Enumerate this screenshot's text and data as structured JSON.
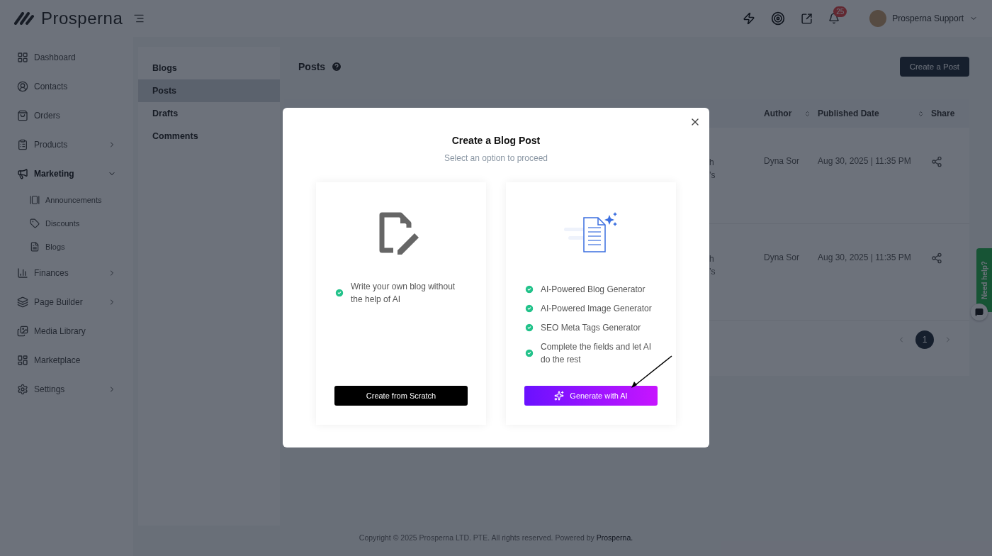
{
  "header": {
    "brand": "Prosperna",
    "notification_count": "25",
    "user_name": "Prosperna Support"
  },
  "sidebar": {
    "items": [
      {
        "label": "Dashboard",
        "kind": "link",
        "selected": false
      },
      {
        "label": "Contacts",
        "kind": "link",
        "selected": false
      },
      {
        "label": "Orders",
        "kind": "link",
        "selected": false
      },
      {
        "label": "Products",
        "kind": "group",
        "selected": false,
        "expanded": false
      },
      {
        "label": "Marketing",
        "kind": "group",
        "selected": true,
        "expanded": true,
        "children": [
          {
            "label": "Announcements"
          },
          {
            "label": "Discounts"
          },
          {
            "label": "Blogs"
          }
        ]
      },
      {
        "label": "Finances",
        "kind": "group",
        "selected": false,
        "expanded": false
      },
      {
        "label": "Page Builder",
        "kind": "group",
        "selected": false,
        "expanded": false
      },
      {
        "label": "Media Library",
        "kind": "link",
        "selected": false
      },
      {
        "label": "Marketplace",
        "kind": "link",
        "selected": false
      },
      {
        "label": "Settings",
        "kind": "group",
        "selected": false,
        "expanded": false
      }
    ]
  },
  "subnav": [
    {
      "label": "Blogs",
      "selected": false
    },
    {
      "label": "Posts",
      "selected": true
    },
    {
      "label": "Drafts",
      "selected": false
    },
    {
      "label": "Comments",
      "selected": false
    }
  ],
  "page": {
    "title": "Posts",
    "create_button": "Create a Post"
  },
  "table": {
    "columns": [
      {
        "label": "Author",
        "sortable": true
      },
      {
        "label": "Published Date",
        "sortable": true
      },
      {
        "label": "Share"
      }
    ],
    "rows": [
      {
        "column_1": [
          "h",
          "’s"
        ],
        "author": "Dyna Sor",
        "published": "Aug 30, 2025 | 11:35 PM"
      },
      {
        "column_1": [
          "h",
          "’s"
        ],
        "author": "Dyna Sor",
        "published": "Aug 30, 2025 | 11:35 PM"
      }
    ]
  },
  "pagination": {
    "pages": [
      {
        "label": "1",
        "selected": true
      }
    ]
  },
  "footer": {
    "text": "Copyright © 2025 Prosperna LTD. PTE. All rights reserved. Powered by",
    "link": "Prosperna."
  },
  "help_tab": {
    "label": "Need help?"
  },
  "modal": {
    "title": "Create a Blog Post",
    "subtitle": "Select an option to proceed",
    "options": [
      {
        "kind": "manual",
        "features": [
          "Write your own blog without the help of AI"
        ],
        "button": "Create from Scratch"
      },
      {
        "kind": "ai",
        "features": [
          "AI-Powered Blog Generator",
          "AI-Powered Image Generator",
          "SEO Meta Tags Generator",
          "Complete the fields and let AI do the rest"
        ],
        "button": "Generate with AI"
      }
    ]
  }
}
